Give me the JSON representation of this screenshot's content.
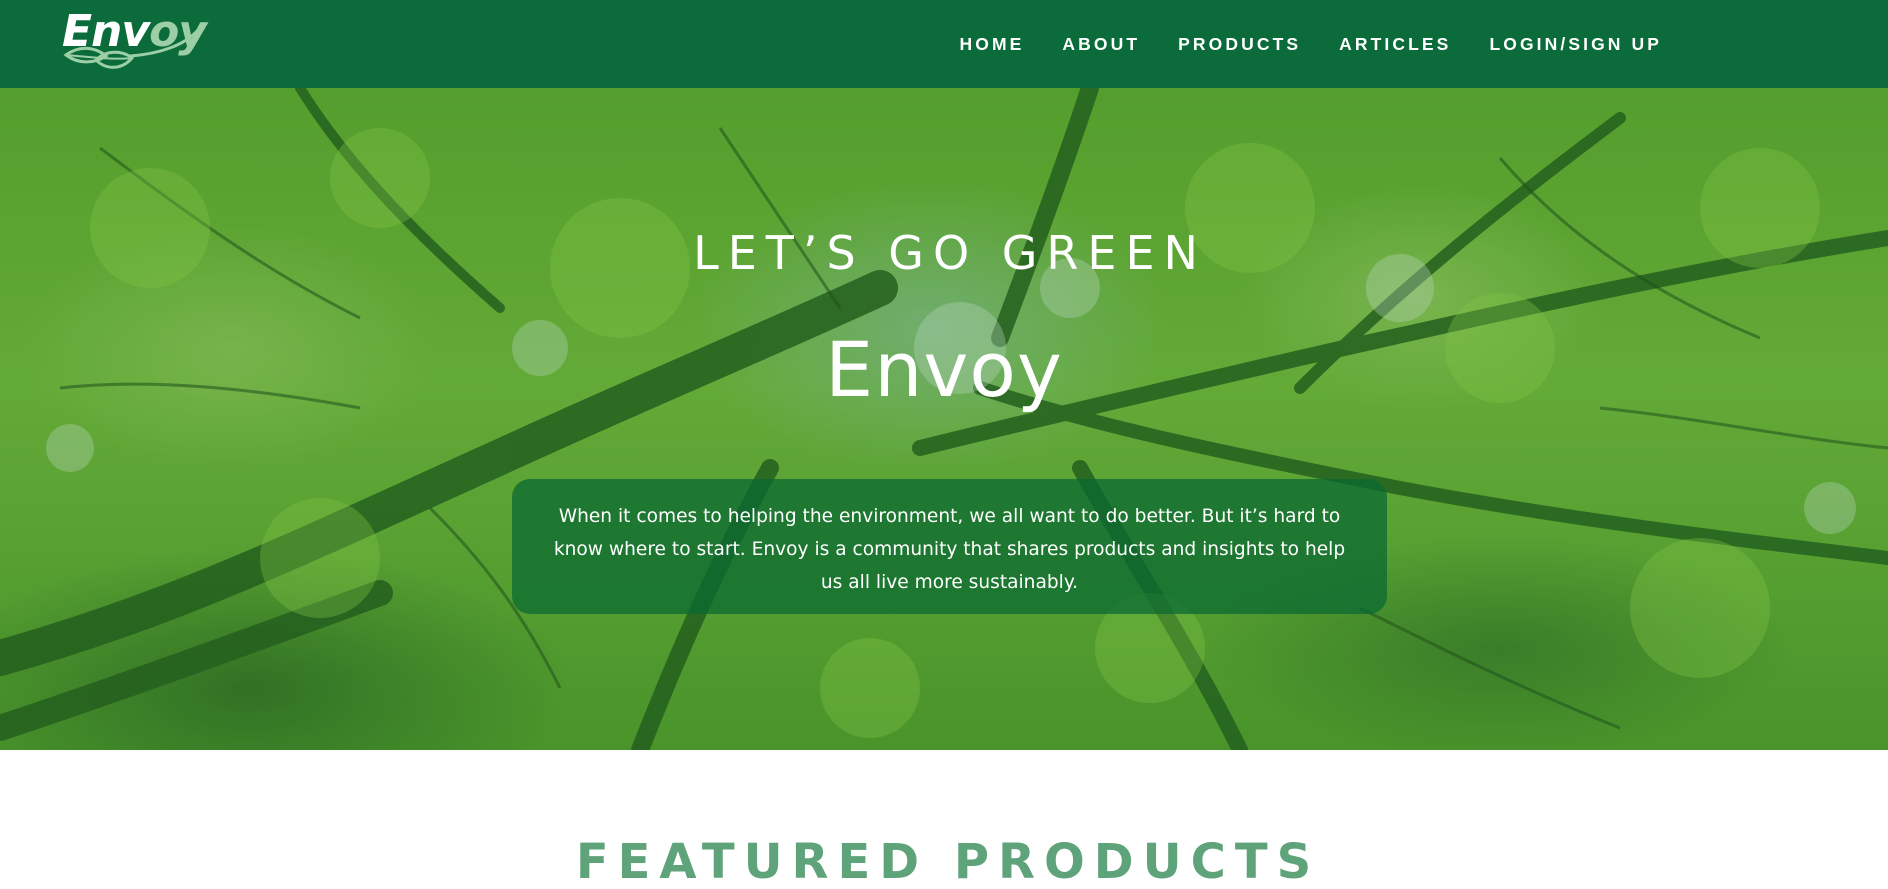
{
  "brand": {
    "logo_text_white": "Env",
    "logo_text_light": "oy",
    "logo_icon": "leaf-icon"
  },
  "nav": {
    "items": [
      {
        "label": "HOME"
      },
      {
        "label": "ABOUT"
      },
      {
        "label": "PRODUCTS"
      },
      {
        "label": "ARTICLES"
      },
      {
        "label": "LOGIN/SIGN UP"
      }
    ]
  },
  "hero": {
    "eyebrow": "LET’S GO GREEN",
    "title": "Envoy",
    "description": "When it comes to helping the environment, we all want to do better. But it’s hard to know where to start. Envoy is a community that shares products and insights to help us all live more sustainably.",
    "background": "forest-canopy-image"
  },
  "featured": {
    "title": "FEATURED PRODUCTS"
  },
  "colors": {
    "header_green": "#0b6b3a",
    "hero_box_green": "#0a6932",
    "featured_title": "#5ea37a",
    "foliage_green": "#5ca62e",
    "white": "#ffffff"
  }
}
